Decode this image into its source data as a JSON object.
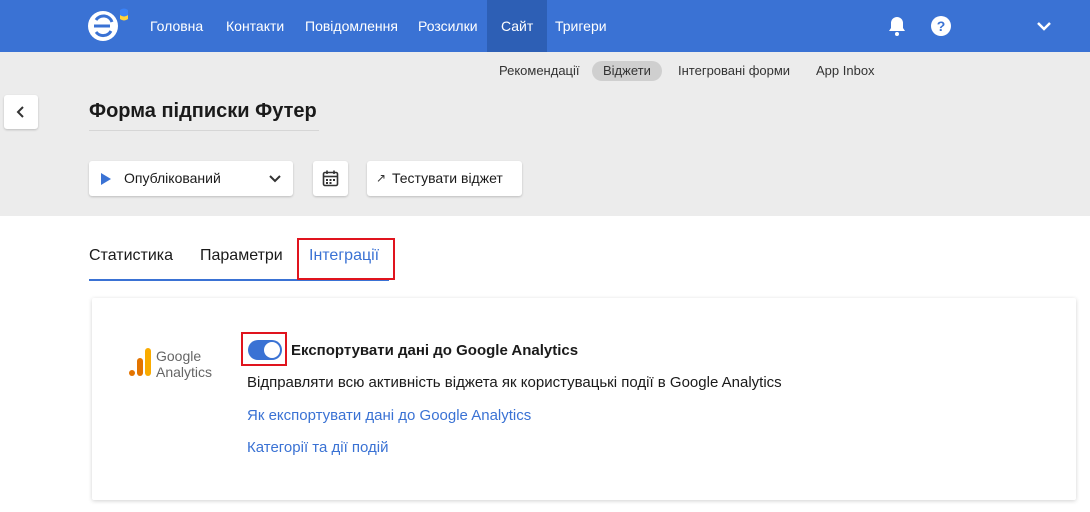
{
  "nav": {
    "items": [
      {
        "label": "Головна"
      },
      {
        "label": "Контакти"
      },
      {
        "label": "Повідомлення"
      },
      {
        "label": "Розсилки"
      },
      {
        "label": "Сайт",
        "active": true
      },
      {
        "label": "Тригери"
      }
    ],
    "icons": [
      "bell-icon",
      "help-icon",
      "chevron-down-icon"
    ]
  },
  "subnav": {
    "items": [
      {
        "label": "Рекомендації"
      },
      {
        "label": "Віджети",
        "active": true
      },
      {
        "label": "Інтегровані форми"
      },
      {
        "label": "App Inbox"
      }
    ]
  },
  "page": {
    "title": "Форма підписки Футер"
  },
  "controls": {
    "status_value": "Опублікований",
    "test_label": "Тестувати віджет"
  },
  "tabs": [
    {
      "label": "Статистика"
    },
    {
      "label": "Параметри"
    },
    {
      "label": "Інтеграції",
      "active": true
    }
  ],
  "integration": {
    "logo_line1": "Google",
    "logo_line2": "Analytics",
    "toggle_on": true,
    "title": "Експортувати дані до Google Analytics",
    "description": "Відправляти всю активність віджета як користувацькі події в Google Analytics",
    "link1": "Як експортувати дані до Google Analytics",
    "link2": "Категорії та дії подій"
  },
  "colors": {
    "brand": "#3a72d4",
    "highlight": "#e0141e"
  }
}
